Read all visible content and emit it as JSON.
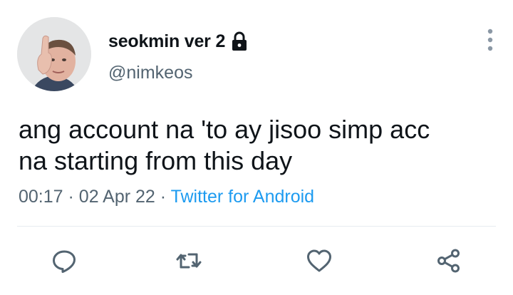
{
  "user": {
    "display_name": "seokmin ver 2",
    "handle": "@nimkeos",
    "protected_icon": "lock-icon",
    "avatar": "thumbs-up-avatar"
  },
  "tweet": {
    "text": "ang account na 'to ay jisoo simp acc\nna starting from this day",
    "time": "00:17",
    "separator": "·",
    "date": "02 Apr 22",
    "source": "Twitter for Android"
  },
  "icons": {
    "more": "more-vertical-icon",
    "reply": "reply-icon",
    "retweet": "retweet-icon",
    "like": "heart-icon",
    "share": "share-icon"
  },
  "colors": {
    "text": "#0f1419",
    "secondary": "#536471",
    "link": "#1d9bf0",
    "icon": "#536471",
    "divider": "#e6ecf0"
  }
}
